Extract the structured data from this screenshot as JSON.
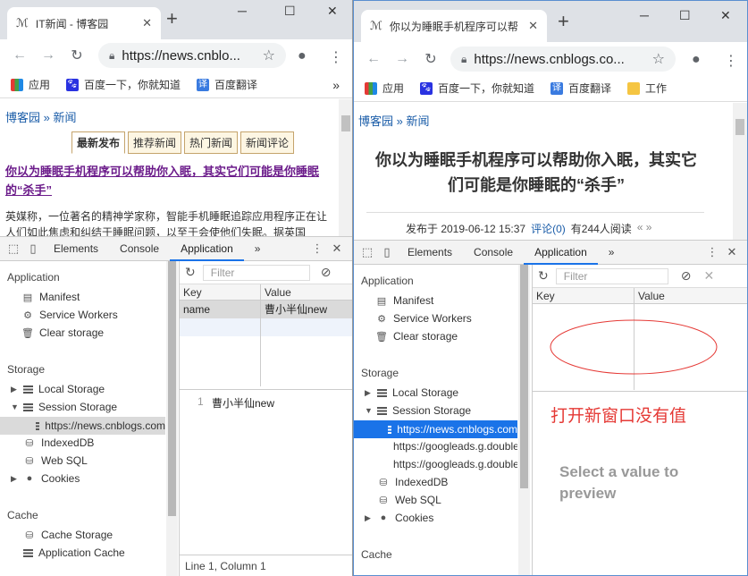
{
  "w1": {
    "tab_title": "IT新闻 - 博客园",
    "url": "https://news.cnblo...",
    "bookmarks": [
      "应用",
      "百度一下，你就知道",
      "百度翻译"
    ],
    "bookmark_overflow": "»",
    "breadcrumb": "博客园 » 新闻",
    "news_tabs": [
      "最新发布",
      "推荐新闻",
      "热门新闻",
      "新闻评论"
    ],
    "headline": "你以为睡眠手机程序可以帮助你入眠，其实它们可能是你睡眠的“杀手”",
    "summary": "英媒称，一位著名的精神学家称，智能手机睡眠追踪应用程序正在让人们如此焦虑和纠结于睡眠问题，以至于会使他们失眠。据英国",
    "devtools_tabs": [
      "Elements",
      "Console",
      "Application",
      "»"
    ],
    "sidebar": {
      "application_header": "Application",
      "application_items": [
        "Manifest",
        "Service Workers",
        "Clear storage"
      ],
      "storage_header": "Storage",
      "local_storage": "Local Storage",
      "session_storage": "Session Storage",
      "session_child": "https://news.cnblogs.com",
      "indexeddb": "IndexedDB",
      "websql": "Web SQL",
      "cookies": "Cookies",
      "cache_header": "Cache",
      "cache_items": [
        "Cache Storage",
        "Application Cache"
      ]
    },
    "filter_placeholder": "Filter",
    "table": {
      "headers": [
        "Key",
        "Value"
      ],
      "rows": [
        {
          "key": "name",
          "value": "曹小半仙new"
        }
      ]
    },
    "preview_line_number": "1",
    "preview_value": "曹小半仙new",
    "status": "Line 1, Column 1"
  },
  "w2": {
    "tab_title": "你以为睡眠手机程序可以帮",
    "url": "https://news.cnblogs.co...",
    "bookmarks": [
      "应用",
      "百度一下，你就知道",
      "百度翻译",
      "工作"
    ],
    "bookmark_overflow": "»",
    "breadcrumb": "博客园 » 新闻",
    "headline": "你以为睡眠手机程序可以帮助你入眠，其实它们可能是你睡眠的“杀手”",
    "meta_published": "发布于 2019-06-12 15:37",
    "meta_comments": "评论(0)",
    "meta_views": "有244人阅读",
    "meta_nav": "« »",
    "devtools_tabs": [
      "Elements",
      "Console",
      "Application",
      "»"
    ],
    "sidebar": {
      "application_header": "Application",
      "application_items": [
        "Manifest",
        "Service Workers",
        "Clear storage"
      ],
      "storage_header": "Storage",
      "local_storage": "Local Storage",
      "session_storage": "Session Storage",
      "session_children": [
        "https://news.cnblogs.com",
        "https://googleads.g.doubleclick.net",
        "https://googleads.g.doubleclick.net"
      ],
      "indexeddb": "IndexedDB",
      "websql": "Web SQL",
      "cookies": "Cookies",
      "cache_header": "Cache"
    },
    "filter_placeholder": "Filter",
    "table": {
      "headers": [
        "Key",
        "Value"
      ]
    },
    "annotation": "打开新窗口没有值",
    "empty_preview": "Select a value to preview"
  },
  "colors": {
    "link": "#1a5ca8",
    "headline_purple": "#6b1b8a",
    "selection": "#1a73e8",
    "annotation_red": "#e53935"
  }
}
